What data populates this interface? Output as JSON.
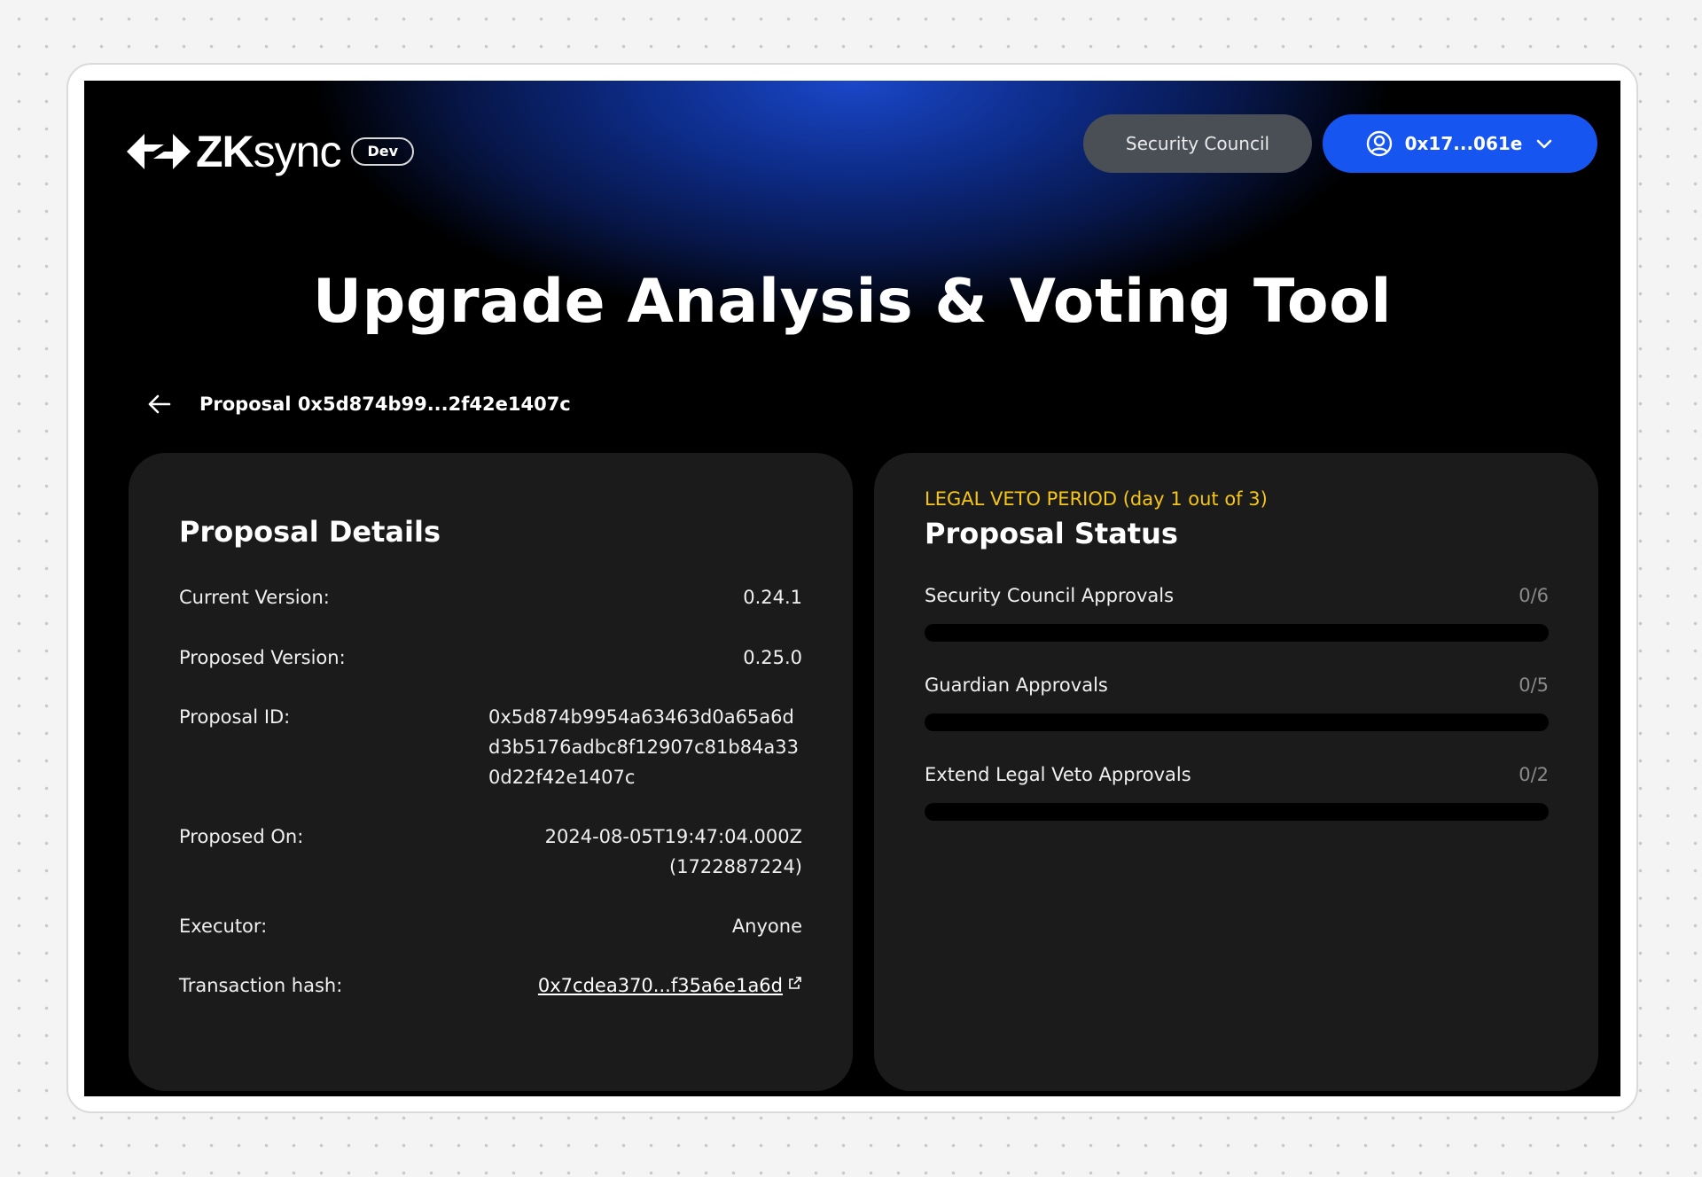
{
  "header": {
    "logo_zk": "ZK",
    "logo_sync": "sync",
    "env_badge": "Dev",
    "council_button": "Security Council",
    "account_address": "0x17...061e",
    "account_icon": "user-circle-icon",
    "dropdown_icon": "chevron-down-icon"
  },
  "page": {
    "title": "Upgrade Analysis & Voting Tool",
    "proposal_crumb": "Proposal 0x5d874b99...2f42e1407c"
  },
  "details": {
    "title": "Proposal Details",
    "rows": [
      {
        "label": "Current Version:",
        "value": "0.24.1"
      },
      {
        "label": "Proposed Version:",
        "value": "0.25.0"
      },
      {
        "label": "Proposal ID:",
        "value": "0x5d874b9954a63463d0a65a6dd3b5176adbc8f12907c81b84a330d22f42e1407c"
      },
      {
        "label": "Proposed On:",
        "value": "2024-08-05T19:47:04.000Z",
        "value2": "(1722887224)"
      },
      {
        "label": "Executor:",
        "value": "Anyone"
      },
      {
        "label": "Transaction hash:",
        "value": "0x7cdea370...f35a6e1a6d"
      }
    ]
  },
  "status": {
    "period": "LEGAL VETO PERIOD (day 1 out of 3)",
    "title": "Proposal Status",
    "approvals": [
      {
        "label": "Security Council Approvals",
        "count": "0/6",
        "progress": 0
      },
      {
        "label": "Guardian Approvals",
        "count": "0/5",
        "progress": 0
      },
      {
        "label": "Extend Legal Veto Approvals",
        "count": "0/2",
        "progress": 0
      }
    ]
  },
  "colors": {
    "accent": "#1755f0",
    "period_text": "#f5c518",
    "card_bg": "#1b1b1b"
  }
}
